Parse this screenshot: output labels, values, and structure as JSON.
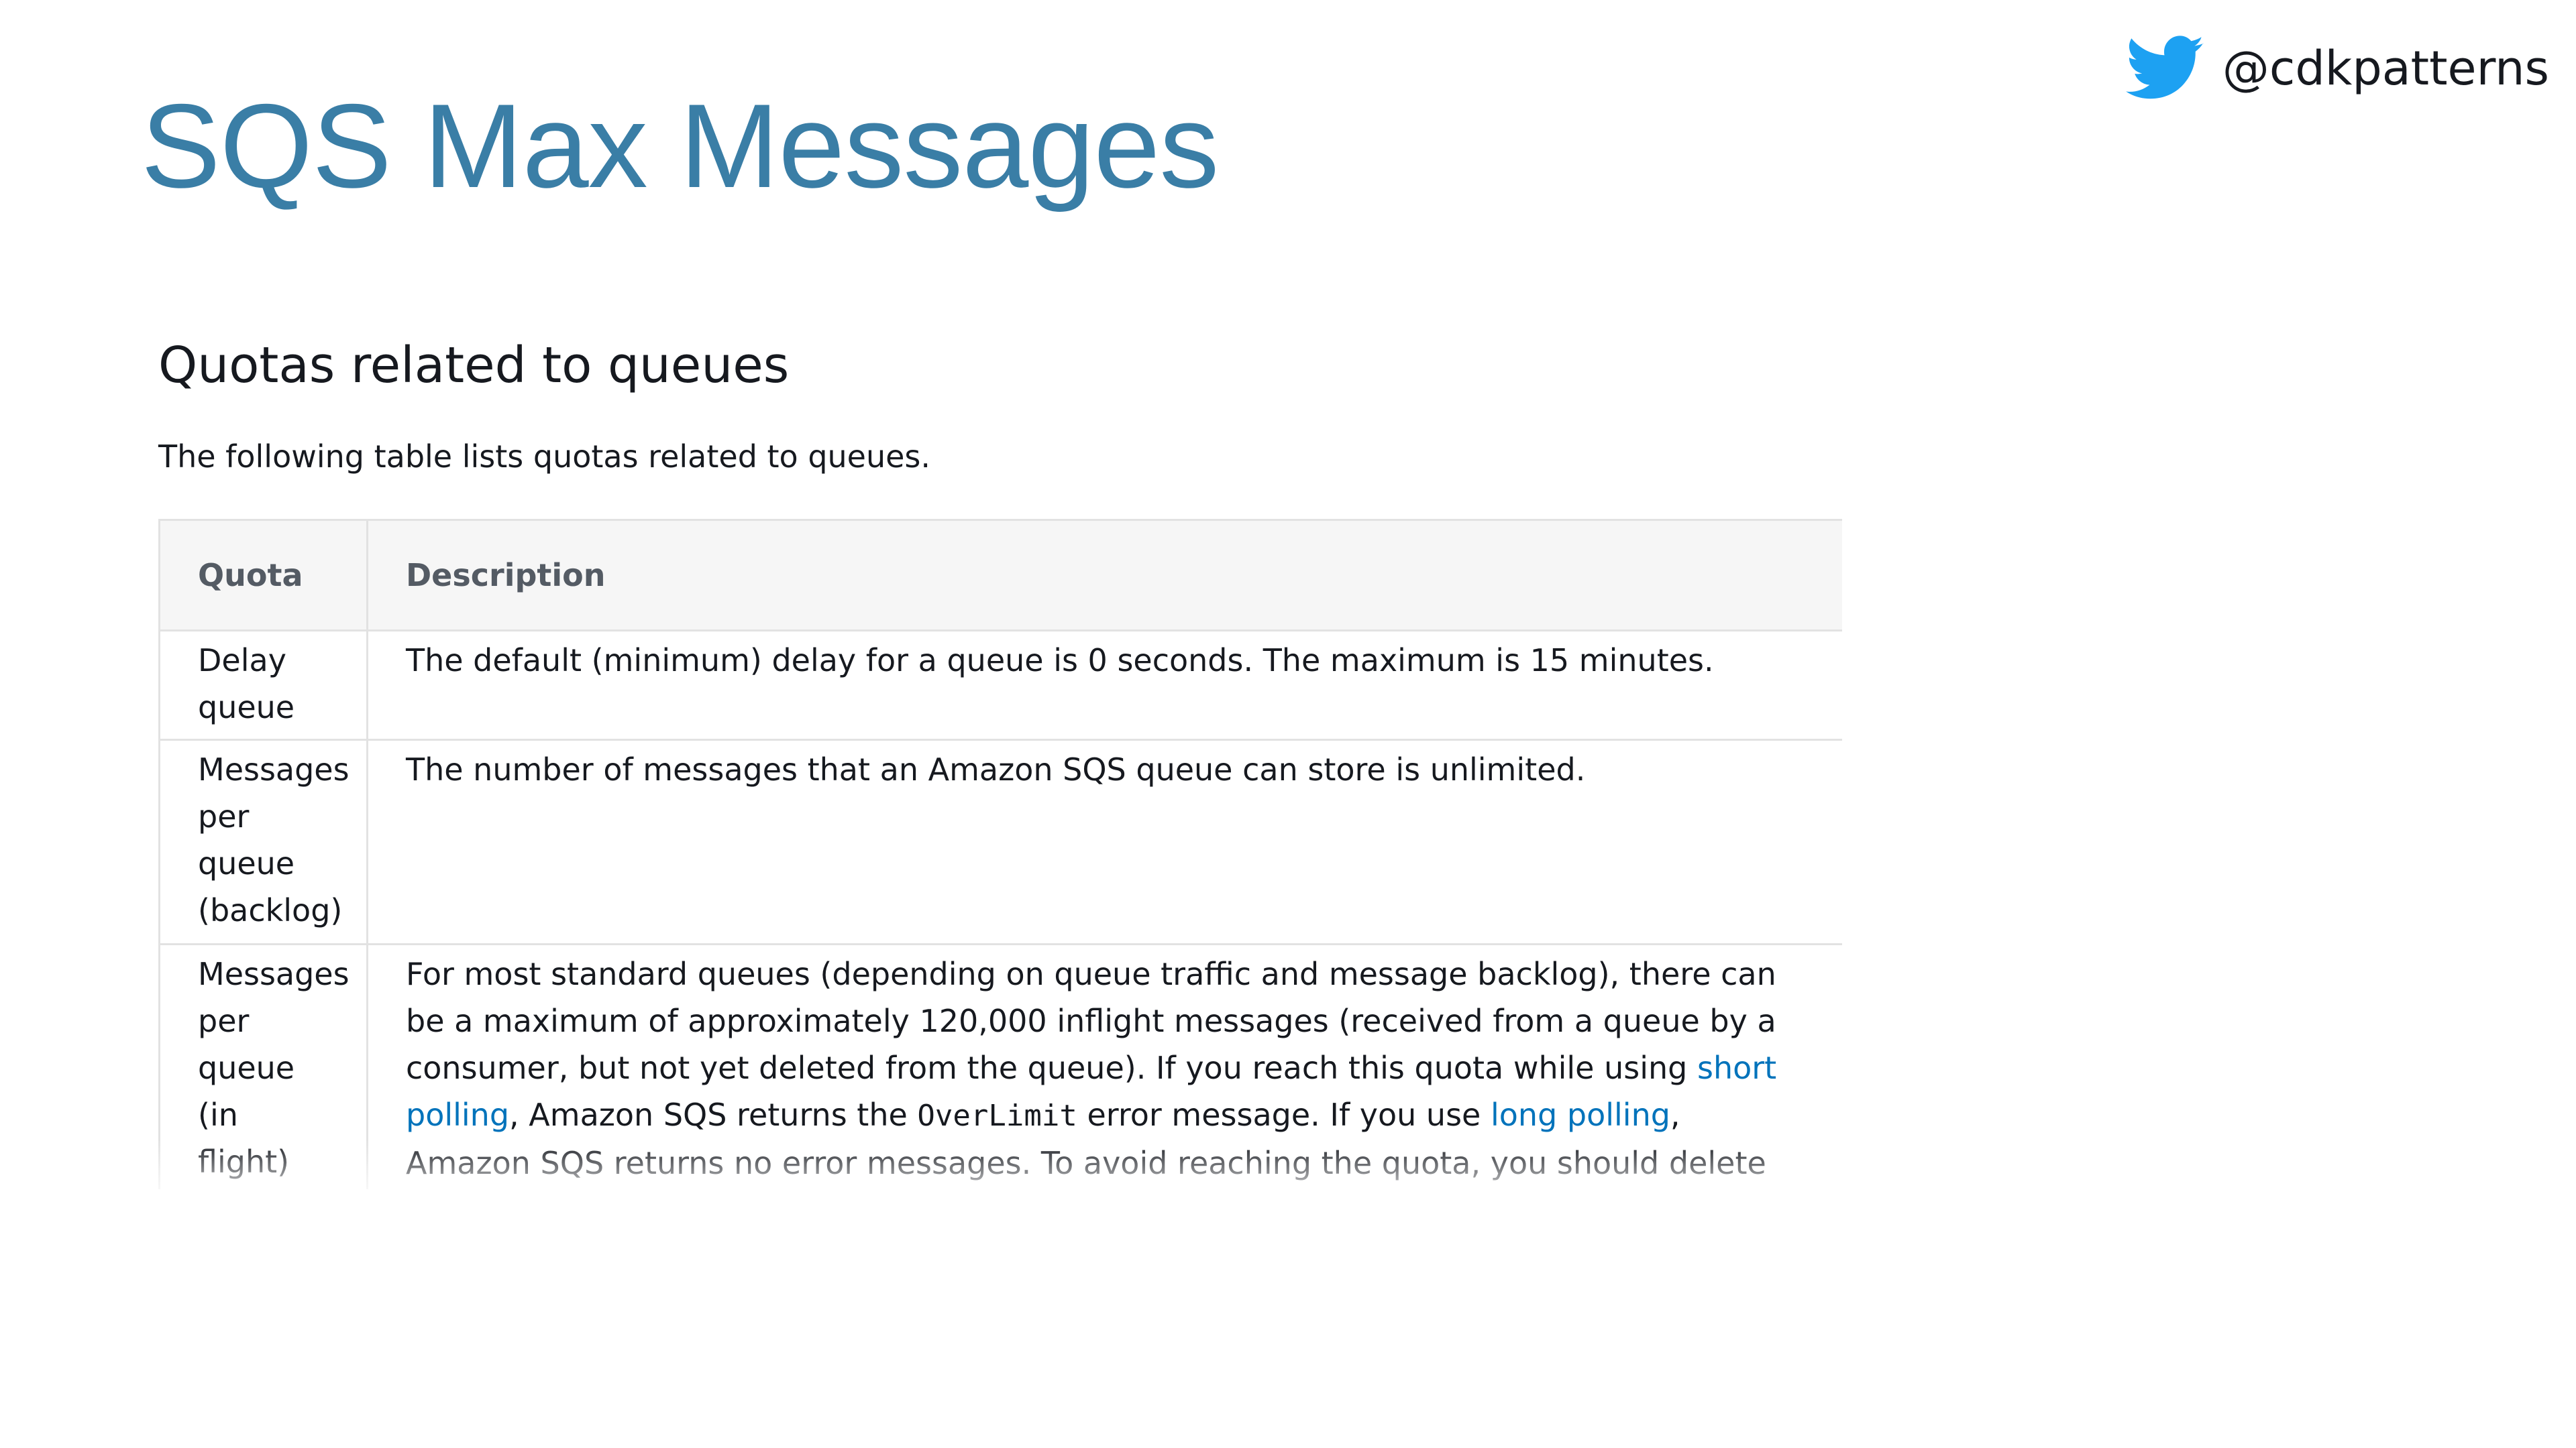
{
  "slide": {
    "title": "SQS Max Messages",
    "handle": "@cdkpatterns",
    "handle_icon": "twitter-bird-icon",
    "title_color": "#3a7ea6",
    "twitter_color": "#1da1f2"
  },
  "doc": {
    "heading": "Quotas related to queues",
    "intro": "The following table lists quotas related to queues.",
    "link_color": "#0073bb"
  },
  "table": {
    "headers": [
      "Quota",
      "Description"
    ],
    "rows": [
      {
        "quota": "Delay queue",
        "description": "The default (minimum) delay for a queue is 0 seconds. The maximum is 15 minutes."
      },
      {
        "quota": "Messages per queue (backlog)",
        "description": "The number of messages that an Amazon SQS queue can store is unlimited."
      },
      {
        "quota": "Messages per queue (in flight)",
        "description_parts": {
          "p1": "For most standard queues (depending on queue traffic and message backlog), there can be a maximum of approximately 120,000 inflight messages (received from a queue by a consumer, but not yet deleted from the queue). If you reach this quota while using ",
          "link1": "short polling",
          "p2": ", Amazon SQS returns the ",
          "code": "OverLimit",
          "p3": " error message. If you use ",
          "link2": "long polling",
          "p4": ", Amazon SQS returns no error messages. To avoid reaching the quota, you should delete messages from the queue after they're"
        }
      }
    ]
  }
}
